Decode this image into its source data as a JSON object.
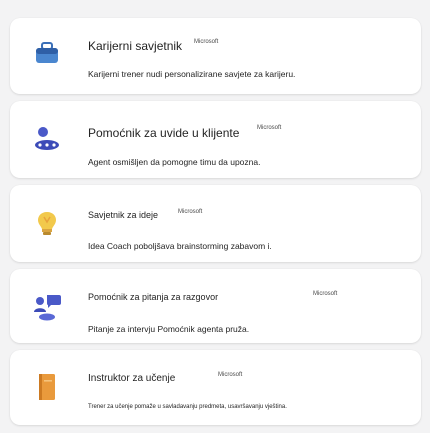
{
  "agents": [
    {
      "title": "Karijerni savjetnik",
      "badge": "Microsoft",
      "description": "Karijerni trener nudi personalizirane savjete za karijeru.",
      "icon": "briefcase-icon"
    },
    {
      "title": "Pomoćnik za uvide u klijente",
      "badge": "Microsoft",
      "description": "Agent osmišljen da pomogne timu da upozna.",
      "icon": "people-icon"
    },
    {
      "title": "Savjetnik za ideje",
      "badge": "Microsoft",
      "description": "Idea Coach poboljšava brainstorming zabavom i.",
      "icon": "lightbulb-icon"
    },
    {
      "title": "Pomoćnik za pitanja za razgovor",
      "badge": "Microsoft",
      "description": "Pitanje za intervju Pomoćnik agenta pruža.",
      "icon": "interview-icon"
    },
    {
      "title": "Instruktor za učenje",
      "badge": "Microsoft",
      "description": "Trener za učenje pomaže u savladavanju predmeta, usavršavanju vještina.",
      "icon": "book-icon"
    }
  ]
}
